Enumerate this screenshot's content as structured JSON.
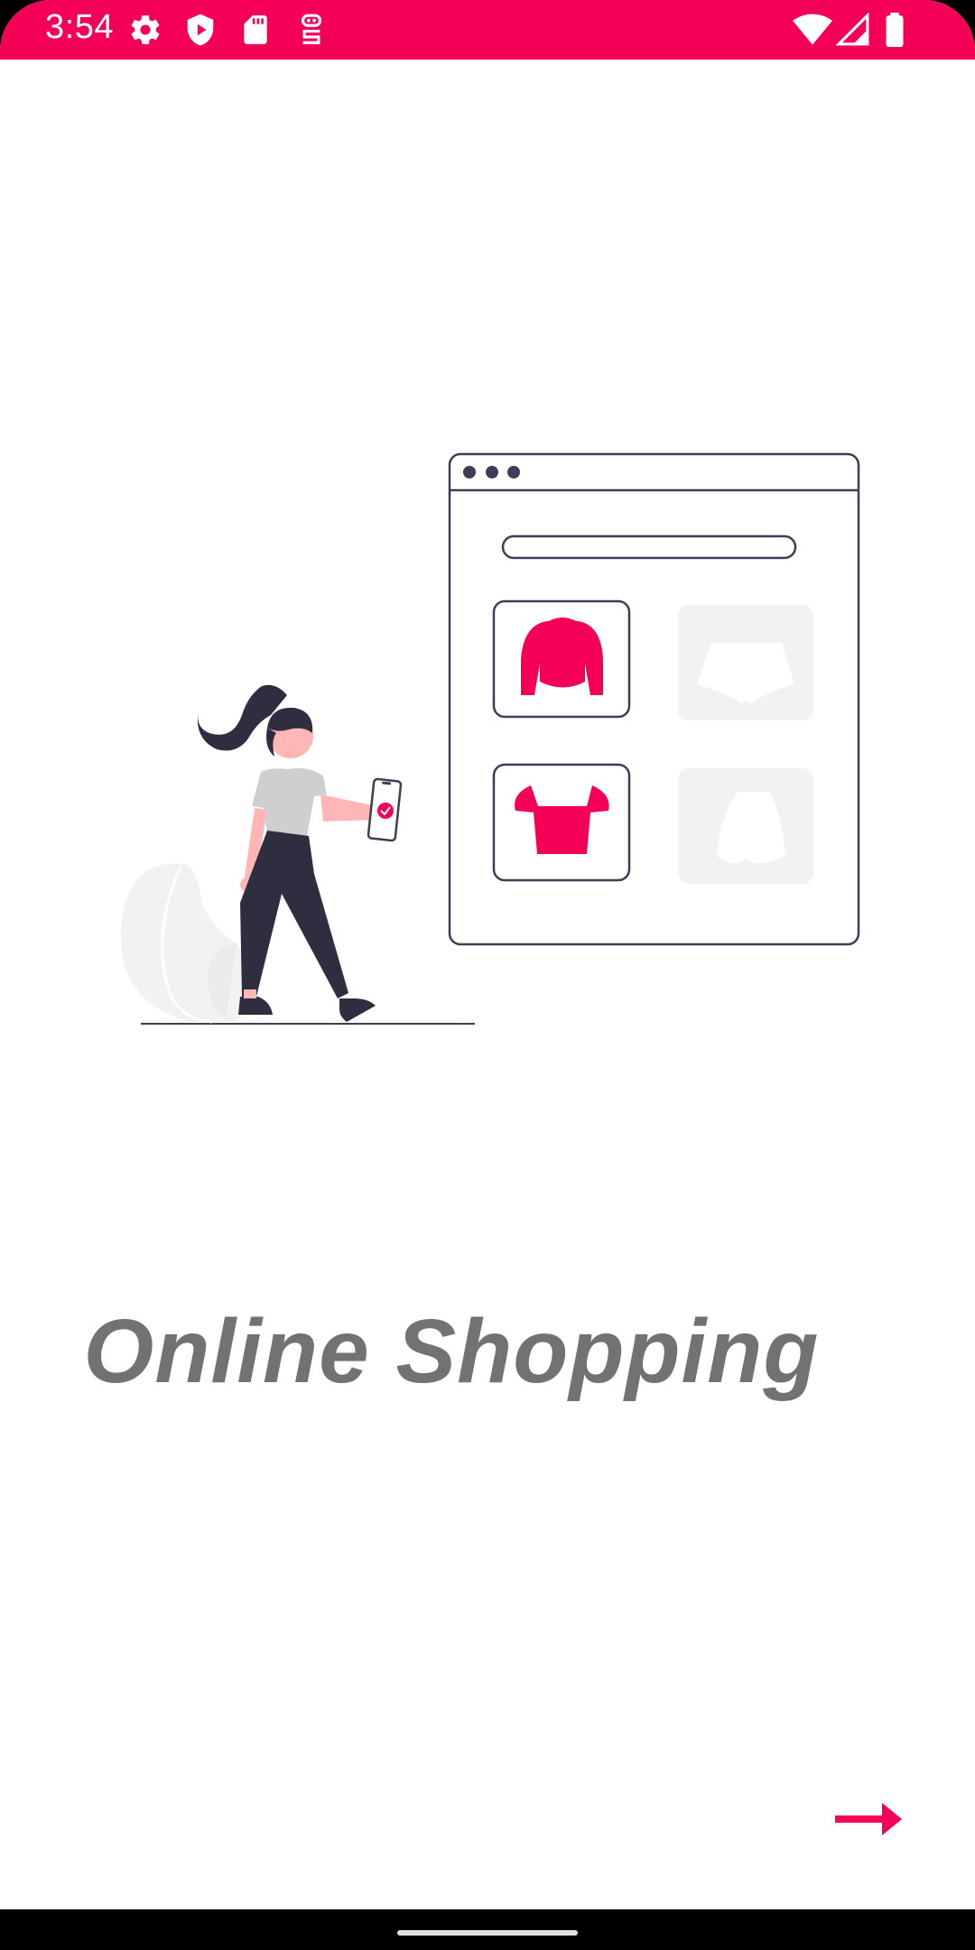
{
  "status_bar": {
    "time": "3:54",
    "left_icons": [
      "gear-icon",
      "shield-play-icon",
      "sd-card-icon",
      "sync-icon"
    ],
    "right_icons": [
      "wifi-icon",
      "signal-icon",
      "battery-icon"
    ],
    "color": "#F50057"
  },
  "onboarding": {
    "title": "Online Shopping",
    "next_icon": "arrow-right-icon"
  },
  "colors": {
    "accent": "#F50057",
    "title_text": "#727272",
    "illustration_dark": "#2F2E41",
    "placeholder": "#F2F2F2"
  }
}
